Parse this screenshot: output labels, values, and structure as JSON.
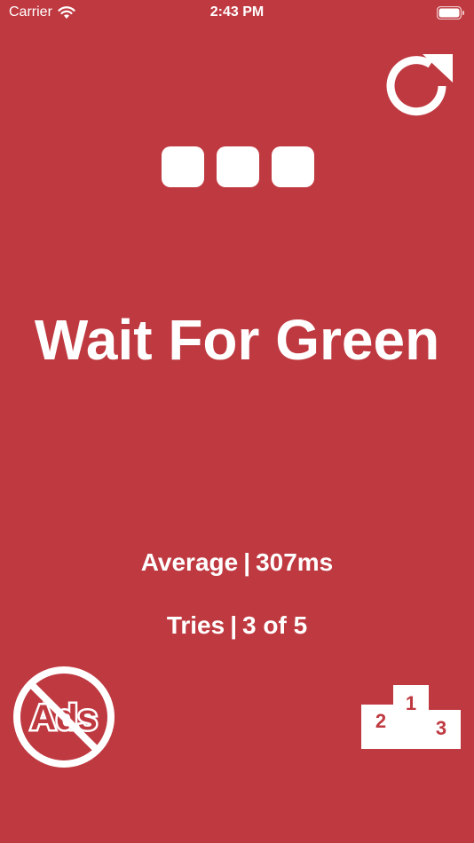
{
  "status_bar": {
    "carrier": "Carrier",
    "time": "2:43 PM"
  },
  "icons": {
    "wifi": "wifi-icon",
    "battery": "battery-icon",
    "restart": "restart-icon",
    "no_ads": "no-ads-icon",
    "leaderboard": "podium-icon"
  },
  "progress_dots_count": 3,
  "headline": "Wait For Green",
  "stats": {
    "average_label": "Average",
    "average_value": "307ms",
    "tries_label": "Tries",
    "tries_value": "3 of 5",
    "separator": "|"
  },
  "no_ads": {
    "text": "Ads"
  },
  "podium": {
    "first": "1",
    "second": "2",
    "third": "3"
  },
  "colors": {
    "background": "#bf3940",
    "foreground": "#ffffff"
  }
}
